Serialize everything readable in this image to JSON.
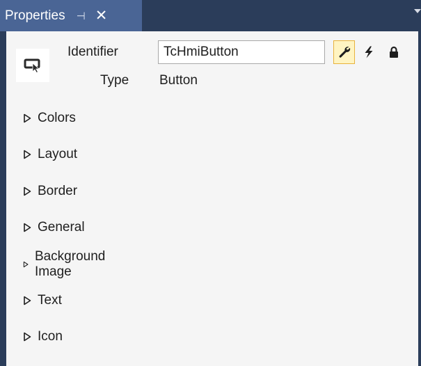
{
  "window": {
    "tab_title": "Properties",
    "pin_glyph": "⊣",
    "close_glyph": "✕",
    "colors": {
      "title_bar": "#2b3d5a",
      "active_tab": "#4a6595",
      "panel": "#f5f5f5",
      "active_button": "#fff4c2"
    }
  },
  "header": {
    "control_icon": "button-control-icon",
    "identifier_label": "Identifier",
    "identifier_value": "TcHmiButton",
    "type_label": "Type",
    "type_value": "Button",
    "toolbar": [
      {
        "icon": "wrench-icon",
        "active": true
      },
      {
        "icon": "lightning-icon",
        "active": false
      },
      {
        "icon": "lock-icon",
        "active": false
      }
    ]
  },
  "categories": [
    "Colors",
    "Layout",
    "Border",
    "General",
    "Background Image",
    "Text",
    "Icon"
  ]
}
